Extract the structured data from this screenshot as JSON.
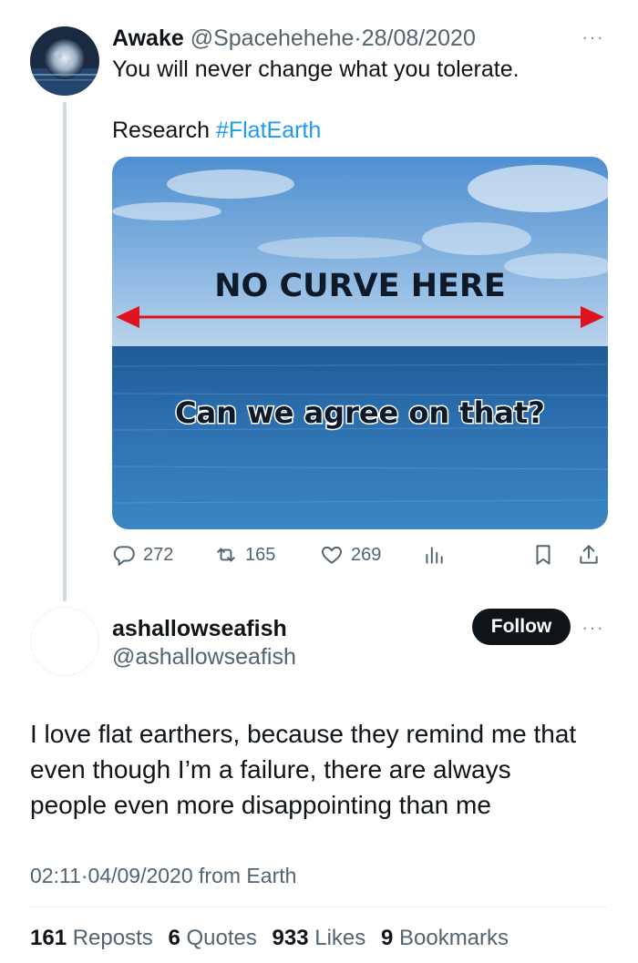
{
  "tweet1": {
    "display_name": "Awake",
    "handle": "@Spacehehehe",
    "separator": "·",
    "date": "28/08/2020",
    "more": "···",
    "text_line1": "You will never change what you tolerate.",
    "text_line2_prefix": "Research",
    "hashtag": "#FlatEarth",
    "image": {
      "headline": "NO CURVE HERE",
      "caption": "Can we agree on that?"
    },
    "actions": {
      "replies": "272",
      "reposts": "165",
      "likes": "269"
    }
  },
  "tweet2": {
    "display_name": "ashallowseafish",
    "handle": "@ashallowseafish",
    "follow_label": "Follow",
    "more": "···",
    "text_line1": "I love flat earthers, because they remind me that",
    "text_line2": "even though I’m a failure, there are always",
    "text_line3": "people even more disappointing than me",
    "time": "02:11",
    "separator": "·",
    "date": "04/09/2020",
    "source": "from Earth",
    "stats": {
      "reposts_count": "161",
      "reposts_label": "Reposts",
      "quotes_count": "6",
      "quotes_label": "Quotes",
      "likes_count": "933",
      "likes_label": "Likes",
      "bookmarks_count": "9",
      "bookmarks_label": "Bookmarks"
    }
  },
  "colors": {
    "link": "#1d9bf0",
    "muted": "#536471",
    "text": "#0f1419",
    "arrow": "#e0141e"
  }
}
